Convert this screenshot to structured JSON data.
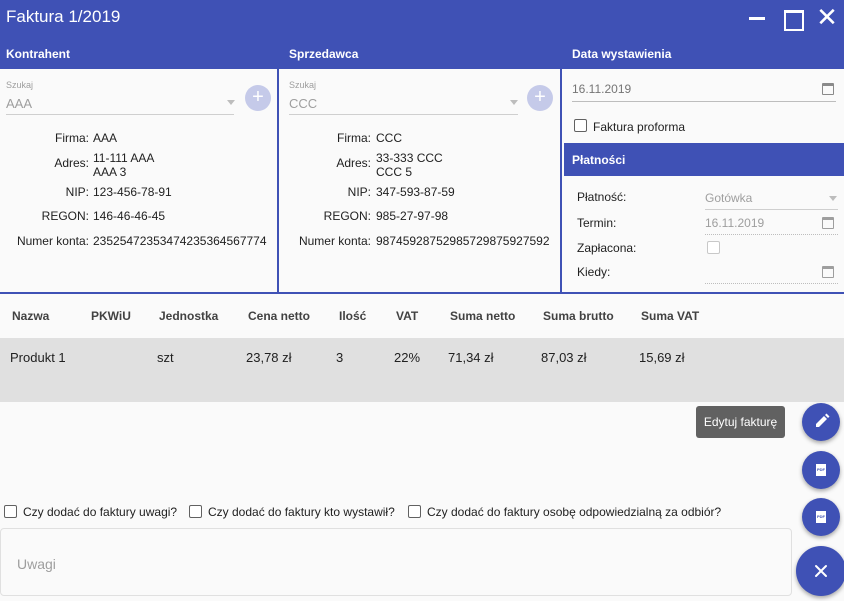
{
  "window": {
    "title": "Faktura 1/2019"
  },
  "sections": {
    "kontrahent": "Kontrahent",
    "sprzedawca": "Sprzedawca",
    "data_wystawienia": "Data wystawienia",
    "platnosci": "Płatności"
  },
  "kontrahent": {
    "search_label": "Szukaj",
    "search_value": "AAA",
    "firma_label": "Firma:",
    "firma": "AAA",
    "adres_label": "Adres:",
    "adres_line1": "11-111 AAA",
    "adres_line2": "AAA 3",
    "nip_label": "NIP:",
    "nip": "123-456-78-91",
    "regon_label": "REGON:",
    "regon": "146-46-46-45",
    "konto_label": "Numer konta:",
    "konto": "23525472353474235364567774"
  },
  "sprzedawca": {
    "search_label": "Szukaj",
    "search_value": "CCC",
    "firma_label": "Firma:",
    "firma": "CCC",
    "adres_label": "Adres:",
    "adres_line1": "33-333 CCC",
    "adres_line2": "CCC 5",
    "nip_label": "NIP:",
    "nip": "347-593-87-59",
    "regon_label": "REGON:",
    "regon": "985-27-97-98",
    "konto_label": "Numer konta:",
    "konto": "98745928752985729875927592"
  },
  "data": {
    "date": "16.11.2019",
    "proforma_label": "Faktura proforma"
  },
  "platnosci": {
    "platnosc_label": "Płatność:",
    "platnosc_value": "Gotówka",
    "termin_label": "Termin:",
    "termin_value": "16.11.2019",
    "zaplacona_label": "Zapłacona:",
    "kiedy_label": "Kiedy:"
  },
  "table": {
    "headers": [
      "Nazwa",
      "PKWiU",
      "Jednostka",
      "Cena netto",
      "Ilość",
      "VAT",
      "Suma netto",
      "Suma brutto",
      "Suma VAT"
    ],
    "rows": [
      [
        "Produkt 1",
        "",
        "szt",
        "23,78 zł",
        "3",
        "22%",
        "71,34 zł",
        "87,03 zł",
        "15,69 zł"
      ]
    ]
  },
  "actions": {
    "edit_tooltip": "Edytuj fakturę",
    "pdf_label": "PDF"
  },
  "options": {
    "uwagi": "Czy dodać do faktury uwagi?",
    "kto_wystawil": "Czy dodać do faktury kto wystawił?",
    "odbior": "Czy dodać do faktury osobę odpowiedzialną za odbiór?"
  },
  "uwagi_placeholder": "Uwagi",
  "colors": {
    "primary": "#3f51b5",
    "row_bg": "#e0e0e0",
    "tooltip_bg": "#616161"
  }
}
